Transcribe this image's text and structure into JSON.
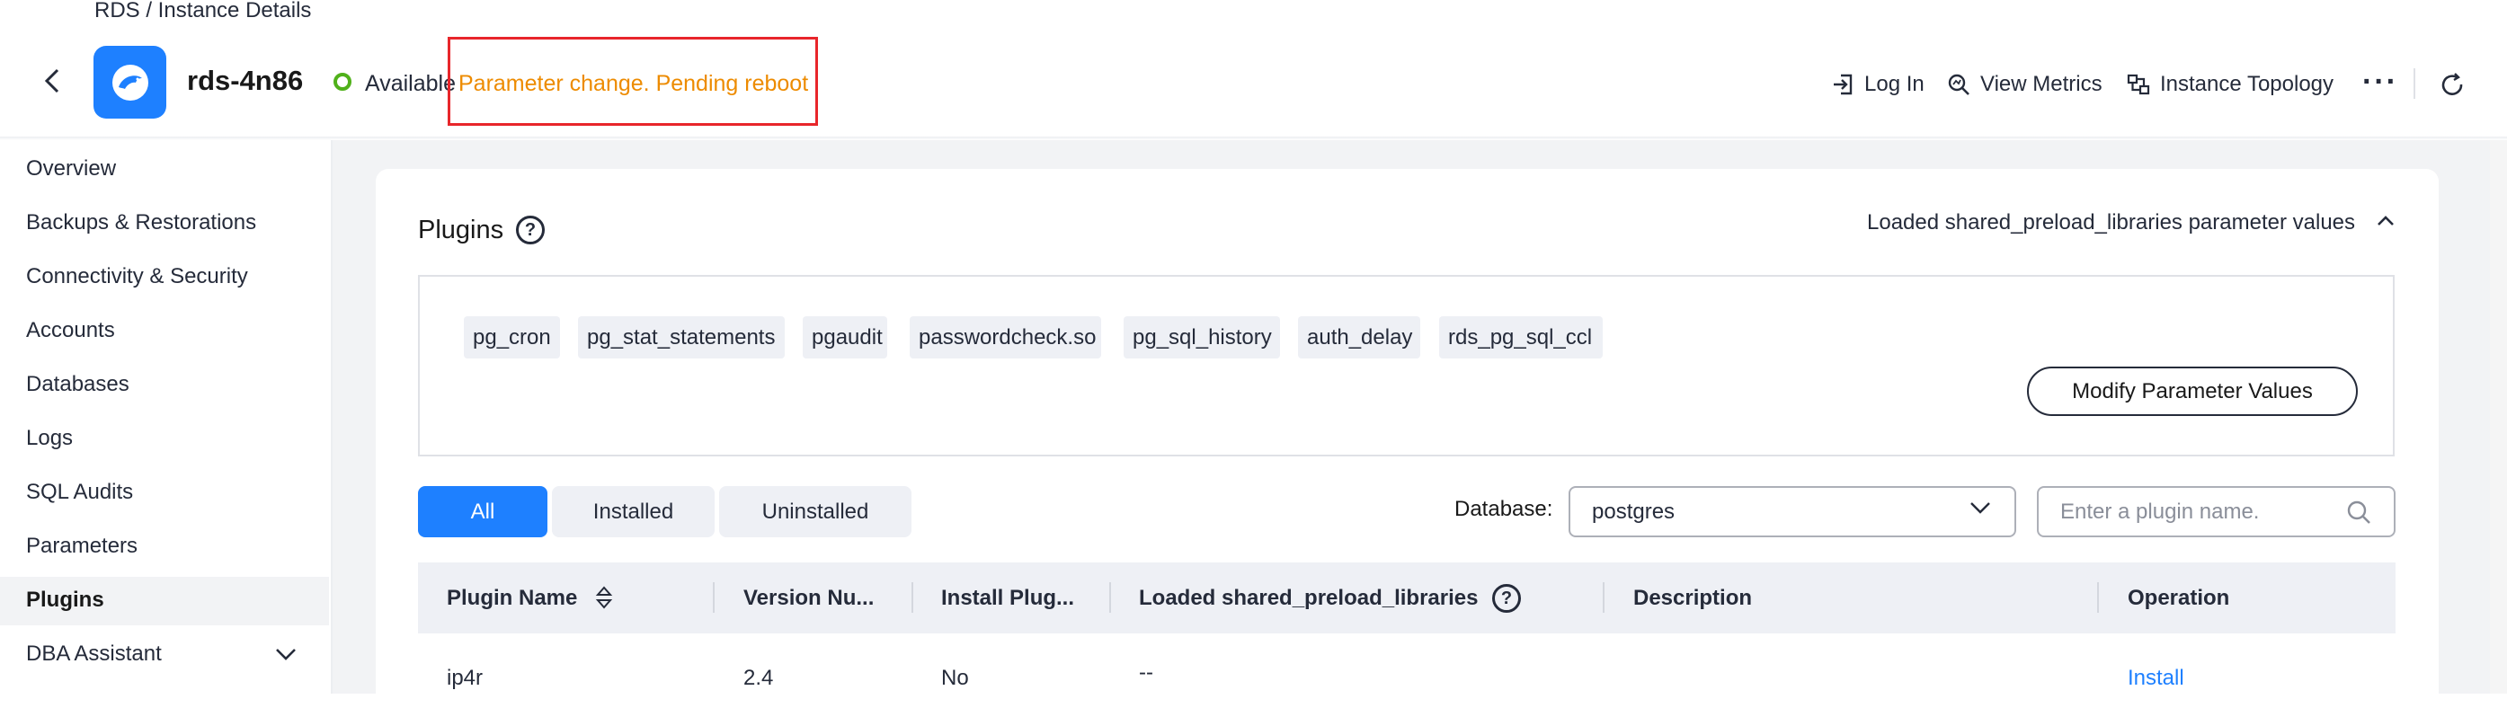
{
  "header": {
    "breadcrumb": "RDS / Instance Details",
    "instance_name": "rds-4n86",
    "status": "Available",
    "pending_note": "Parameter change. Pending reboot",
    "actions": {
      "log_in": "Log In",
      "view_metrics": "View Metrics",
      "instance_topology": "Instance Topology"
    },
    "more": "···"
  },
  "sidebar": {
    "items": [
      {
        "label": "Overview"
      },
      {
        "label": "Backups & Restorations"
      },
      {
        "label": "Connectivity & Security"
      },
      {
        "label": "Accounts"
      },
      {
        "label": "Databases"
      },
      {
        "label": "Logs"
      },
      {
        "label": "SQL Audits"
      },
      {
        "label": "Parameters"
      },
      {
        "label": "Plugins"
      },
      {
        "label": "DBA Assistant"
      }
    ],
    "active": "Plugins"
  },
  "plugins": {
    "title": "Plugins",
    "help": "?",
    "loaded_toggle": "Loaded shared_preload_libraries parameter values",
    "libraries": [
      "pg_cron",
      "pg_stat_statements",
      "pgaudit",
      "passwordcheck.so",
      "pg_sql_history",
      "auth_delay",
      "rds_pg_sql_ccl"
    ],
    "modify_button": "Modify Parameter Values",
    "tabs": [
      "All",
      "Installed",
      "Uninstalled"
    ],
    "active_tab": "All",
    "database_label": "Database:",
    "database_value": "postgres",
    "search_placeholder": "Enter a plugin name.",
    "table": {
      "columns": [
        "Plugin Name",
        "Version Nu...",
        "Install Plug...",
        "Loaded shared_preload_libraries",
        "Description",
        "Operation"
      ],
      "rows": [
        {
          "name": "ip4r",
          "version": "2.4",
          "installed": "No",
          "loaded": "--",
          "description": "",
          "operation": "Install"
        }
      ]
    }
  },
  "colors": {
    "primary": "#1e80ff",
    "pending": "#ed8b00",
    "status_ok": "#50b11a",
    "highlight": "#e8262b"
  }
}
